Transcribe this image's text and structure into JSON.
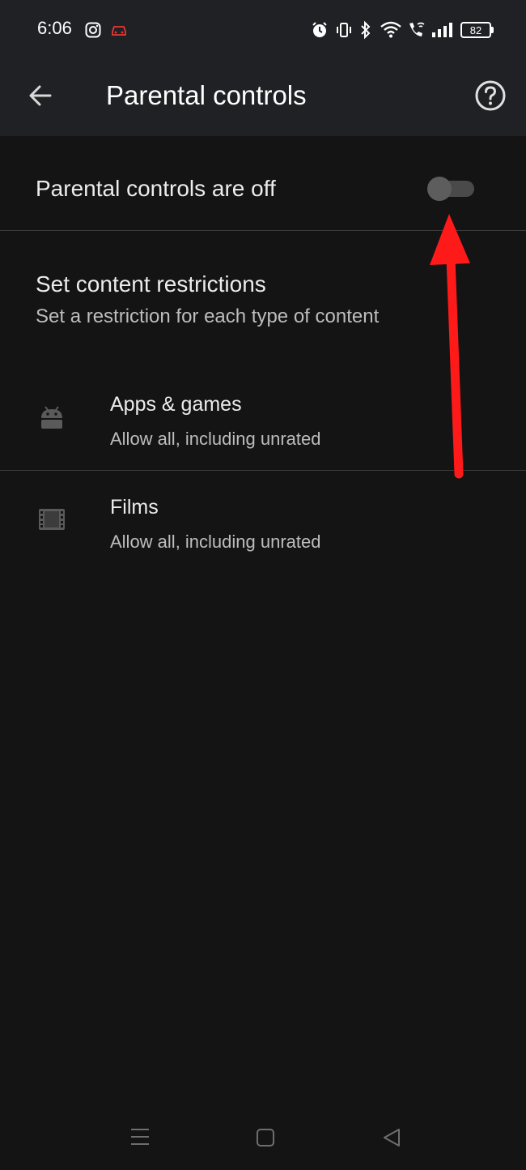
{
  "status_bar": {
    "time": "6:06",
    "battery": "82",
    "icons": [
      "instagram-icon",
      "car-icon",
      "alarm-icon",
      "vibrate-icon",
      "bluetooth-icon",
      "wifi-icon",
      "wifi-calling-icon",
      "signal-icon",
      "battery-icon"
    ]
  },
  "app_bar": {
    "title": "Parental controls",
    "back_icon": "arrow-left-icon",
    "help_icon": "help-circle-icon"
  },
  "toggle_row": {
    "label": "Parental controls are off",
    "state": "off"
  },
  "restrictions": {
    "title": "Set content restrictions",
    "subtitle": "Set a restriction for each type of content",
    "items": [
      {
        "icon": "android-icon",
        "title": "Apps & games",
        "subtitle": "Allow all, including unrated"
      },
      {
        "icon": "film-icon",
        "title": "Films",
        "subtitle": "Allow all, including unrated"
      }
    ]
  },
  "annotation": {
    "arrow_color": "#ff1a1a"
  },
  "colors": {
    "background": "#141414",
    "app_bar": "#202124"
  },
  "nav_bar": {
    "icons": [
      "menu-icon",
      "home-square-icon",
      "back-triangle-icon"
    ]
  }
}
